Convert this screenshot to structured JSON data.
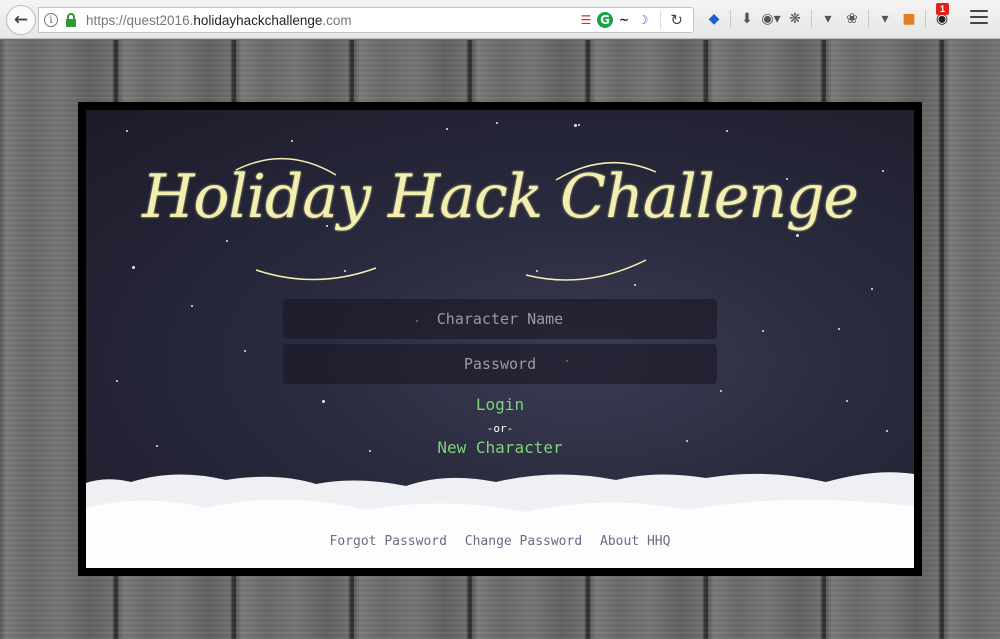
{
  "browser": {
    "url_prefix": "https://quest2016.",
    "url_host": "holidayhackchallenge",
    "url_suffix": ".com",
    "notification_count": "1",
    "icons": [
      "back-icon",
      "info-icon",
      "lock-icon",
      "reload-icon",
      "download-icon",
      "menu-icon"
    ]
  },
  "game": {
    "title": "Holiday Hack Challenge",
    "name_placeholder": "Character Name",
    "password_placeholder": "Password",
    "login_label": "Login",
    "or_label": "-or-",
    "new_character_label": "New Character"
  },
  "footer": {
    "forgot_password": "Forgot Password",
    "change_password": "Change Password",
    "about": "About HHQ"
  },
  "colors": {
    "title": "#f3efb0",
    "link_green": "#7fd37a",
    "footer_link": "#6e6a86",
    "sky": "#29293d"
  }
}
